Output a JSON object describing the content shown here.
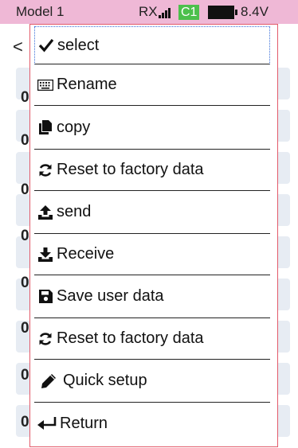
{
  "status": {
    "model": "Model 1",
    "rx": "RX",
    "channel": "C1",
    "voltage": "8.4V"
  },
  "back_glyph": "<",
  "background_rows": [
    "0",
    "0",
    "0",
    "0",
    "0",
    "0",
    "0",
    "0"
  ],
  "menu": {
    "items": [
      {
        "label": "select",
        "icon": "checkmark-icon"
      },
      {
        "label": "Rename",
        "icon": "keyboard-icon"
      },
      {
        "label": "copy",
        "icon": "copy-icon"
      },
      {
        "label": "Reset to factory data",
        "icon": "refresh-icon"
      },
      {
        "label": "send",
        "icon": "upload-icon"
      },
      {
        "label": "Receive",
        "icon": "download-icon"
      },
      {
        "label": "Save user data",
        "icon": "save-icon"
      },
      {
        "label": "Reset to factory data",
        "icon": "refresh-icon"
      },
      {
        "label": "Quick setup",
        "icon": "pencil-icon"
      },
      {
        "label": "Return",
        "icon": "return-arrow-icon"
      }
    ]
  },
  "colors": {
    "status_bar": "#efb8d6",
    "channel_badge": "#4cc04c",
    "menu_border": "#e25a6a",
    "row_background": "#e7ecf3"
  }
}
